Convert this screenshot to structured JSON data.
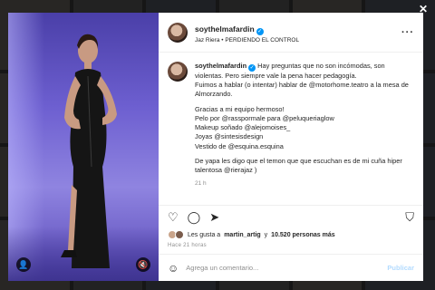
{
  "post": {
    "username": "soythelmafardin",
    "subtitle": "Jaz Riera • PERDIENDO EL CONTROL",
    "caption": {
      "username": "soythelmafardin",
      "lines": [
        "Hay preguntas que no son incómodas, son violentas. Pero siempre vale la pena hacer pedagogía.",
        "Fuimos a hablar (o intentar) hablar de @motorhome.teatro a la mesa de Almorzando.",
        "Gracias a mi equipo hermoso!",
        "Pelo por @rasspormale para @peluqueriaglow",
        "Makeup soñado @alejomoises_",
        "Joyas @sintesisdesign",
        "Vestido de @esquina.esquina",
        "De yapa les digo que el temon que que escuchan es de mi cuña hiper talentosa @rierajaz )"
      ],
      "time": "21 h"
    },
    "likes_prefix": "Les gusta a",
    "likes_user": "martin_artig",
    "likes_mid": "y",
    "likes_count": "10.520 personas más",
    "posted_ago": "Hace 21 horas",
    "comment_placeholder": "Agrega un comentario...",
    "post_button": "Publicar"
  },
  "icons": {
    "more": "more-options-icon",
    "heart": "heart-icon",
    "comment": "comment-icon",
    "share": "share-icon",
    "save": "bookmark-icon",
    "emoji": "emoji-icon",
    "close": "close-icon",
    "user": "user-tag-icon",
    "mute": "mute-icon"
  },
  "colors": {
    "verified": "#0095f6",
    "link": "#00376b"
  }
}
